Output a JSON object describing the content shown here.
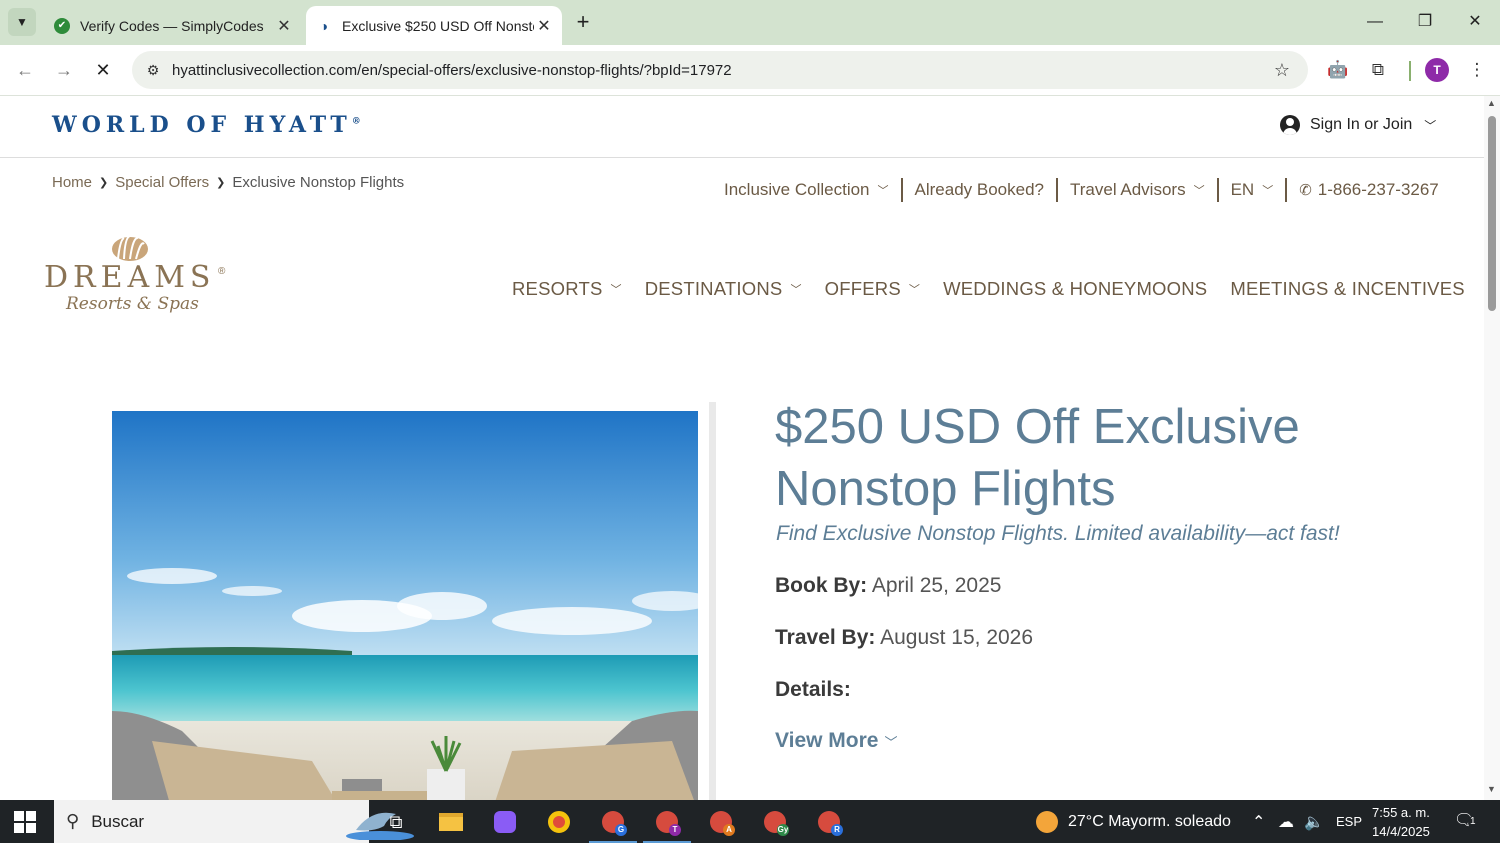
{
  "browser": {
    "tabs": [
      {
        "title": "Verify Codes — SimplyCodes",
        "active": false
      },
      {
        "title": "Exclusive $250 USD Off Nonsto",
        "active": true
      }
    ],
    "url": "hyattinclusivecollection.com/en/special-offers/exclusive-nonstop-flights/?bpId=17972",
    "profile_initial": "T"
  },
  "header": {
    "brand": "WORLD OF HYATT",
    "brand_reg": "®",
    "signin_label": "Sign In or Join"
  },
  "breadcrumb": {
    "items": [
      "Home",
      "Special Offers",
      "Exclusive Nonstop Flights"
    ]
  },
  "utility_nav": {
    "inclusive": "Inclusive Collection",
    "booked": "Already Booked?",
    "advisors": "Travel Advisors",
    "language": "EN",
    "phone": "1-866-237-3267"
  },
  "logo": {
    "name": "DREAMS",
    "reg": "®",
    "subtitle": "Resorts & Spas"
  },
  "main_nav": {
    "resorts": "RESORTS",
    "destinations": "DESTINATIONS",
    "offers": "OFFERS",
    "weddings": "WEDDINGS & HONEYMOONS",
    "meetings": "MEETINGS & INCENTIVES"
  },
  "offer": {
    "title": "$250 USD Off Exclusive Nonstop Flights",
    "subtitle": "Find Exclusive Nonstop Flights. Limited availability—act fast!",
    "book_by_label": "Book By:",
    "book_by_value": "April 25, 2025",
    "travel_by_label": "Travel By:",
    "travel_by_value": "August 15, 2026",
    "details_label": "Details:",
    "view_more": "View More"
  },
  "taskbar": {
    "search_placeholder": "Buscar",
    "weather": "27°C  Mayorm. soleado",
    "language": "ESP",
    "time": "7:55 a. m.",
    "date": "14/4/2025",
    "notifications": "1",
    "app_badges": [
      "G",
      "T",
      "A",
      "Gy",
      "R"
    ]
  },
  "colors": {
    "tabstrip": "#d3e3cf",
    "hyatt_blue": "#1a4f8b",
    "dreams_brown": "#8a7354",
    "offer_blue": "#5d7e96",
    "taskbar": "#1f2326"
  }
}
